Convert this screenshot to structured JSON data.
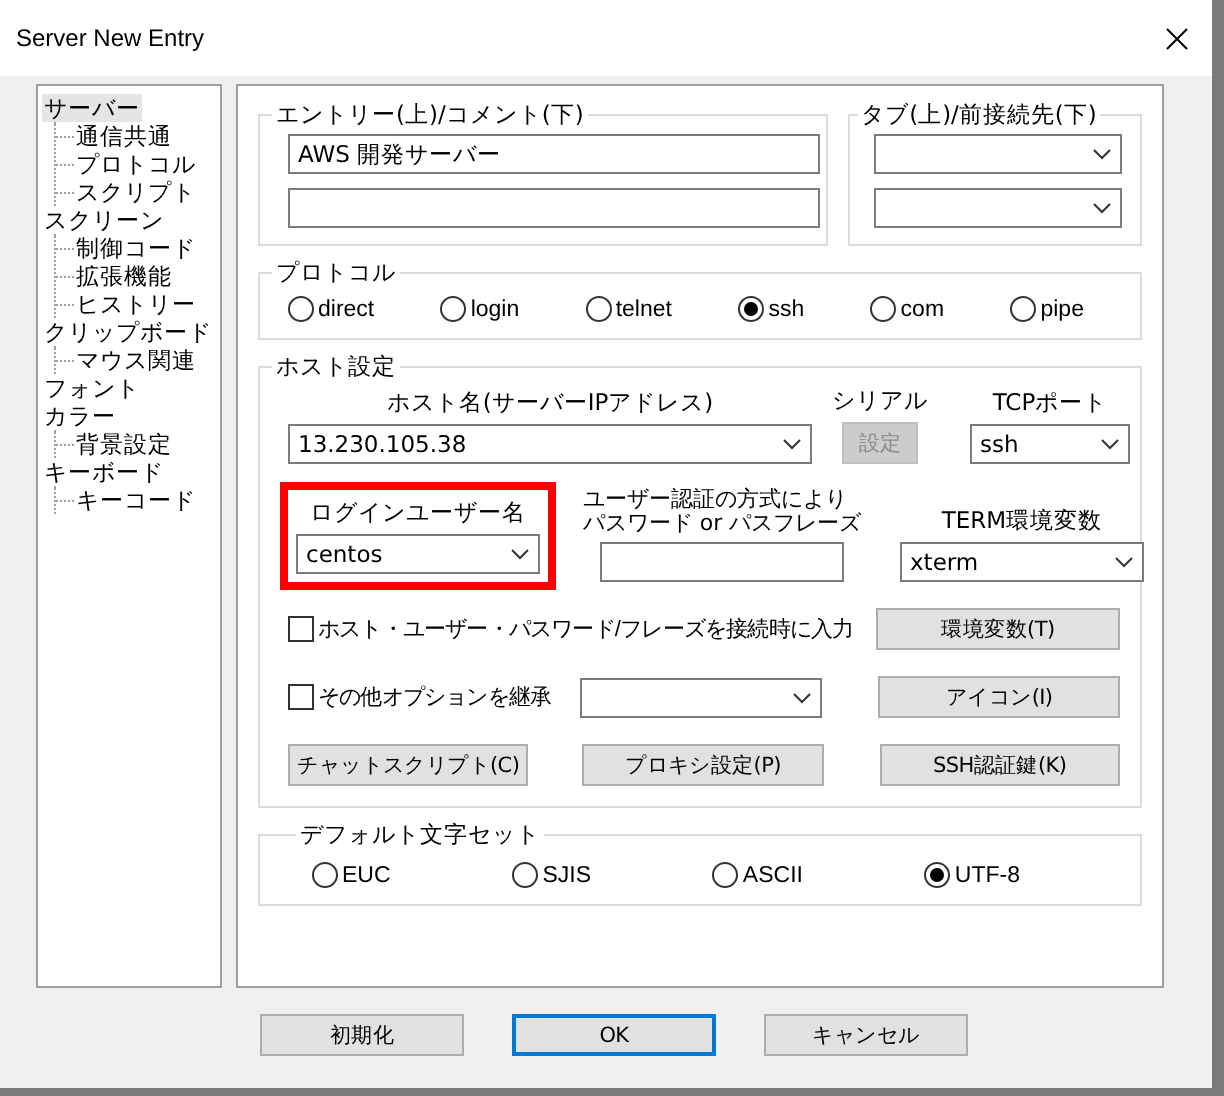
{
  "window": {
    "title": "Server New Entry"
  },
  "tree": [
    {
      "label": "サーバー",
      "selected": true,
      "children": [
        {
          "label": "通信共通",
          "selected": false
        },
        {
          "label": "プロトコル",
          "selected": false
        },
        {
          "label": "スクリプト",
          "selected": false
        }
      ]
    },
    {
      "label": "スクリーン",
      "selected": false,
      "children": [
        {
          "label": "制御コード",
          "selected": false
        },
        {
          "label": "拡張機能",
          "selected": false
        },
        {
          "label": "ヒストリー",
          "selected": false
        }
      ]
    },
    {
      "label": "クリップボード",
      "selected": false,
      "children": [
        {
          "label": "マウス関連",
          "selected": false
        }
      ]
    },
    {
      "label": "フォント",
      "selected": false
    },
    {
      "label": "カラー",
      "selected": false,
      "children": [
        {
          "label": "背景設定",
          "selected": false
        }
      ]
    },
    {
      "label": "キーボード",
      "selected": false,
      "children": [
        {
          "label": "キーコード",
          "selected": false
        }
      ]
    }
  ],
  "entry": {
    "title": "エントリー(上)/コメント(下)",
    "value": "AWS 開発サーバー"
  },
  "tab": {
    "title": "タブ(上)/前接続先(下)"
  },
  "protocol": {
    "title": "プロトコル",
    "options": [
      {
        "label": "direct",
        "selected": false
      },
      {
        "label": "login",
        "selected": false
      },
      {
        "label": "telnet",
        "selected": false
      },
      {
        "label": "ssh",
        "selected": true
      },
      {
        "label": "com",
        "selected": false
      },
      {
        "label": "pipe",
        "selected": false
      }
    ]
  },
  "host": {
    "title": "ホスト設定",
    "hostname": {
      "label": "ホスト名(サーバーIPアドレス)",
      "value": "13.230.105.38"
    },
    "serial": {
      "label": "シリアル",
      "button": "設定",
      "disabled": true
    },
    "port": {
      "label": "TCPポート",
      "value": "ssh"
    },
    "login": {
      "label": "ログインユーザー名",
      "value": "centos",
      "highlighted": true
    },
    "auth": {
      "label_lines": [
        "ユーザー認証の方式により",
        "パスワード or パスフレーズ"
      ]
    },
    "term": {
      "label": "TERM環境変数",
      "value": "xterm"
    },
    "prompt_check": {
      "label": "ホスト・ユーザー・パスワード/フレーズを接続時に入力",
      "checked": false
    },
    "inherit_check": {
      "label": "その他オプションを継承",
      "checked": false
    },
    "buttons": [
      "環境変数(T)",
      "アイコン(I)",
      "チャットスクリプト(C)",
      "プロキシ設定(P)",
      "SSH認証鍵(K)"
    ]
  },
  "charset": {
    "title": "デフォルト文字セット",
    "options": [
      {
        "label": "EUC",
        "selected": false
      },
      {
        "label": "SJIS",
        "selected": false
      },
      {
        "label": "ASCII",
        "selected": false
      },
      {
        "label": "UTF-8",
        "selected": true
      }
    ]
  },
  "footer_buttons": [
    {
      "label": "初期化",
      "default": false
    },
    {
      "label": "OK",
      "default": true
    },
    {
      "label": "キャンセル",
      "default": false
    }
  ]
}
